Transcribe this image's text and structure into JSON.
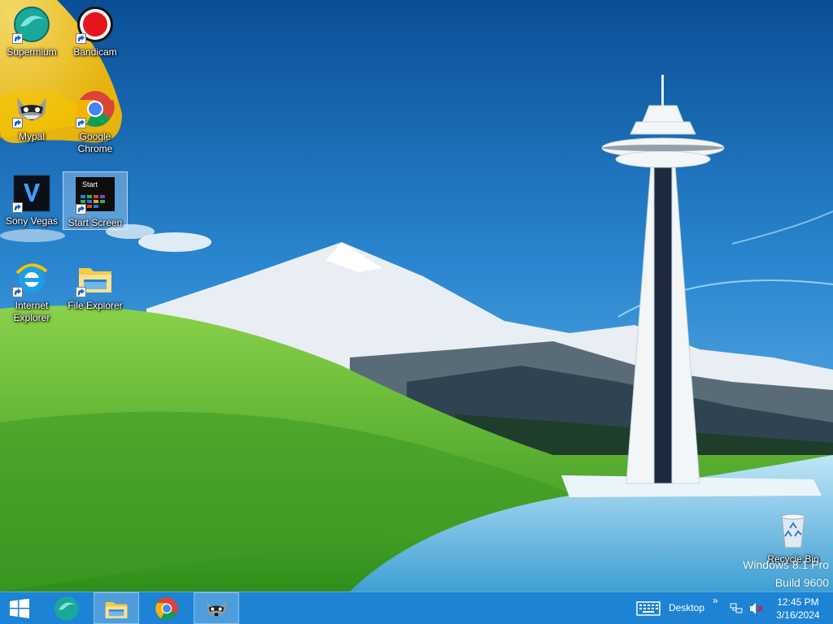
{
  "desktop": {
    "icons": [
      {
        "id": "supermium",
        "label": "Supermium",
        "icon": "supermium-icon"
      },
      {
        "id": "bandicam",
        "label": "Bandicam",
        "icon": "bandicam-icon"
      },
      {
        "id": "mypal",
        "label": "Mypal",
        "icon": "mypal-raccoon-icon"
      },
      {
        "id": "chrome",
        "label": "Google Chrome",
        "icon": "chrome-icon"
      },
      {
        "id": "sony-vegas",
        "label": "Sony Vegas",
        "icon": "sony-vegas-icon"
      },
      {
        "id": "start-screen",
        "label": "Start Screen",
        "icon": "start-screen-icon",
        "icon_text": "Start",
        "selected": true
      },
      {
        "id": "internet-explorer",
        "label": "Internet Explorer",
        "icon": "internet-explorer-icon"
      },
      {
        "id": "file-explorer",
        "label": "File Explorer",
        "icon": "file-explorer-icon"
      },
      {
        "id": "recycle-bin",
        "label": "Recycle Bin",
        "icon": "recycle-bin-icon"
      }
    ],
    "watermark": {
      "line1": "Windows 8.1 Pro",
      "line2": "Build 9600"
    }
  },
  "taskbar": {
    "start_icon": "windows-logo-icon",
    "pinned": [
      {
        "id": "supermium",
        "icon": "supermium-icon",
        "active": false
      },
      {
        "id": "file-explorer",
        "icon": "file-explorer-icon",
        "active": true
      },
      {
        "id": "chrome",
        "icon": "chrome-icon",
        "active": false
      },
      {
        "id": "mypal",
        "icon": "mypal-raccoon-icon",
        "active": true
      }
    ],
    "tray": {
      "keyboard_icon": "touch-keyboard-icon",
      "desktop_label": "Desktop",
      "chevron": "»",
      "network_icon": "network-icon",
      "volume_icon": "volume-muted-icon"
    },
    "clock": {
      "time": "12:45 PM",
      "date": "3/16/2024"
    }
  },
  "colors": {
    "taskbar": "#1d83d4",
    "sky_top": "#0a4f96",
    "sky_bottom": "#5fb3ea",
    "hill_green": "#4caf2a",
    "bandicam_red": "#e8141c",
    "flare_yellow": "#f7c615"
  }
}
